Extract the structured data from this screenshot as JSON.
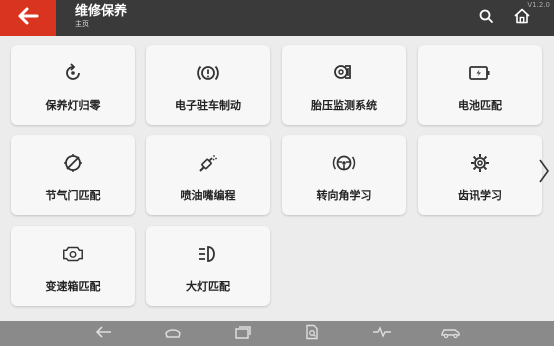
{
  "header": {
    "title": "维修保养",
    "breadcrumb": "主页",
    "version": "V1.2.0",
    "accent_color": "#d9341f",
    "bar_color": "#3a3a3a",
    "icons": [
      "back-arrow-icon",
      "search-icon",
      "home-icon"
    ]
  },
  "tiles": [
    {
      "label": "保养灯归零",
      "icon": "service-reset-icon"
    },
    {
      "label": "电子驻车制动",
      "icon": "parking-brake-icon"
    },
    {
      "label": "胎压监测系统",
      "icon": "tire-pressure-icon"
    },
    {
      "label": "电池匹配",
      "icon": "battery-icon"
    },
    {
      "label": "节气门匹配",
      "icon": "throttle-icon"
    },
    {
      "label": "喷油嘴编程",
      "icon": "injector-icon"
    },
    {
      "label": "转向角学习",
      "icon": "steering-wheel-icon"
    },
    {
      "label": "齿讯学习",
      "icon": "gear-icon"
    },
    {
      "label": "变速箱匹配",
      "icon": "gearbox-icon"
    },
    {
      "label": "大灯匹配",
      "icon": "headlight-icon"
    }
  ],
  "pager": {
    "icon": "chevron-right-icon"
  },
  "navbar": {
    "icons": [
      "nav-back-icon",
      "nav-home-icon",
      "nav-recent-icon",
      "nav-report-icon",
      "nav-vci-icon",
      "nav-vehicle-icon"
    ]
  }
}
